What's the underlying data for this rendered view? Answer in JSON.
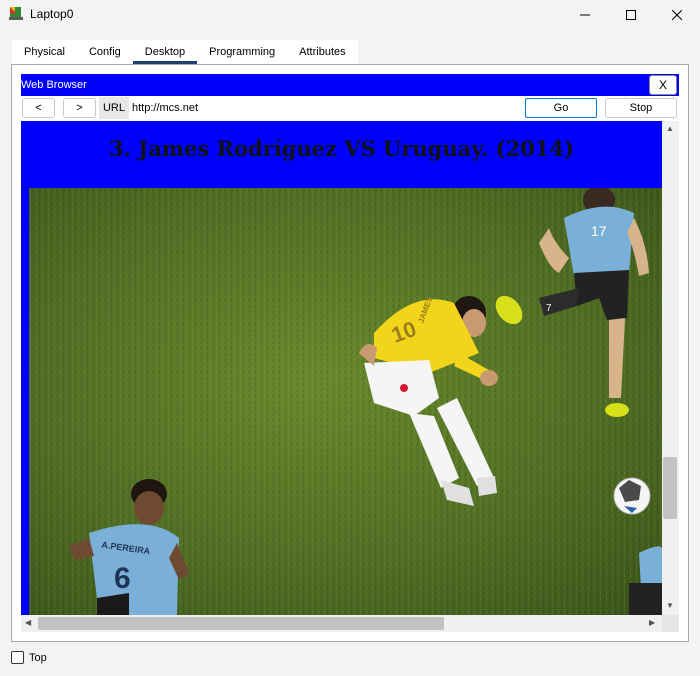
{
  "window": {
    "title": "Laptop0",
    "controls": {
      "minimize": "minimize-icon",
      "maximize": "maximize-icon",
      "close": "close-icon"
    }
  },
  "tabs": [
    {
      "label": "Physical",
      "active": false
    },
    {
      "label": "Config",
      "active": false
    },
    {
      "label": "Desktop",
      "active": true
    },
    {
      "label": "Programming",
      "active": false
    },
    {
      "label": "Attributes",
      "active": false
    }
  ],
  "browser": {
    "title": "Web Browser",
    "close_label": "X",
    "back_label": "<",
    "forward_label": ">",
    "url_label": "URL",
    "url_value": "http://mcs.net",
    "go_label": "Go",
    "stop_label": "Stop",
    "page": {
      "heading": "3. James Rodríguez VS Uruguay. (2014)",
      "background_color": "#0000ff",
      "player_number": "10",
      "player_name": "JAMES",
      "opponent_number_left": "6",
      "opponent_name_left": "A.PEREIRA",
      "opponent_number_right": "17",
      "opponent_number_runner": "7"
    }
  },
  "footer": {
    "top_label": "Top",
    "top_checked": false
  },
  "colors": {
    "accent_tab": "#1f3e6e",
    "browser_blue": "#0000ff",
    "go_border": "#0078d7"
  }
}
